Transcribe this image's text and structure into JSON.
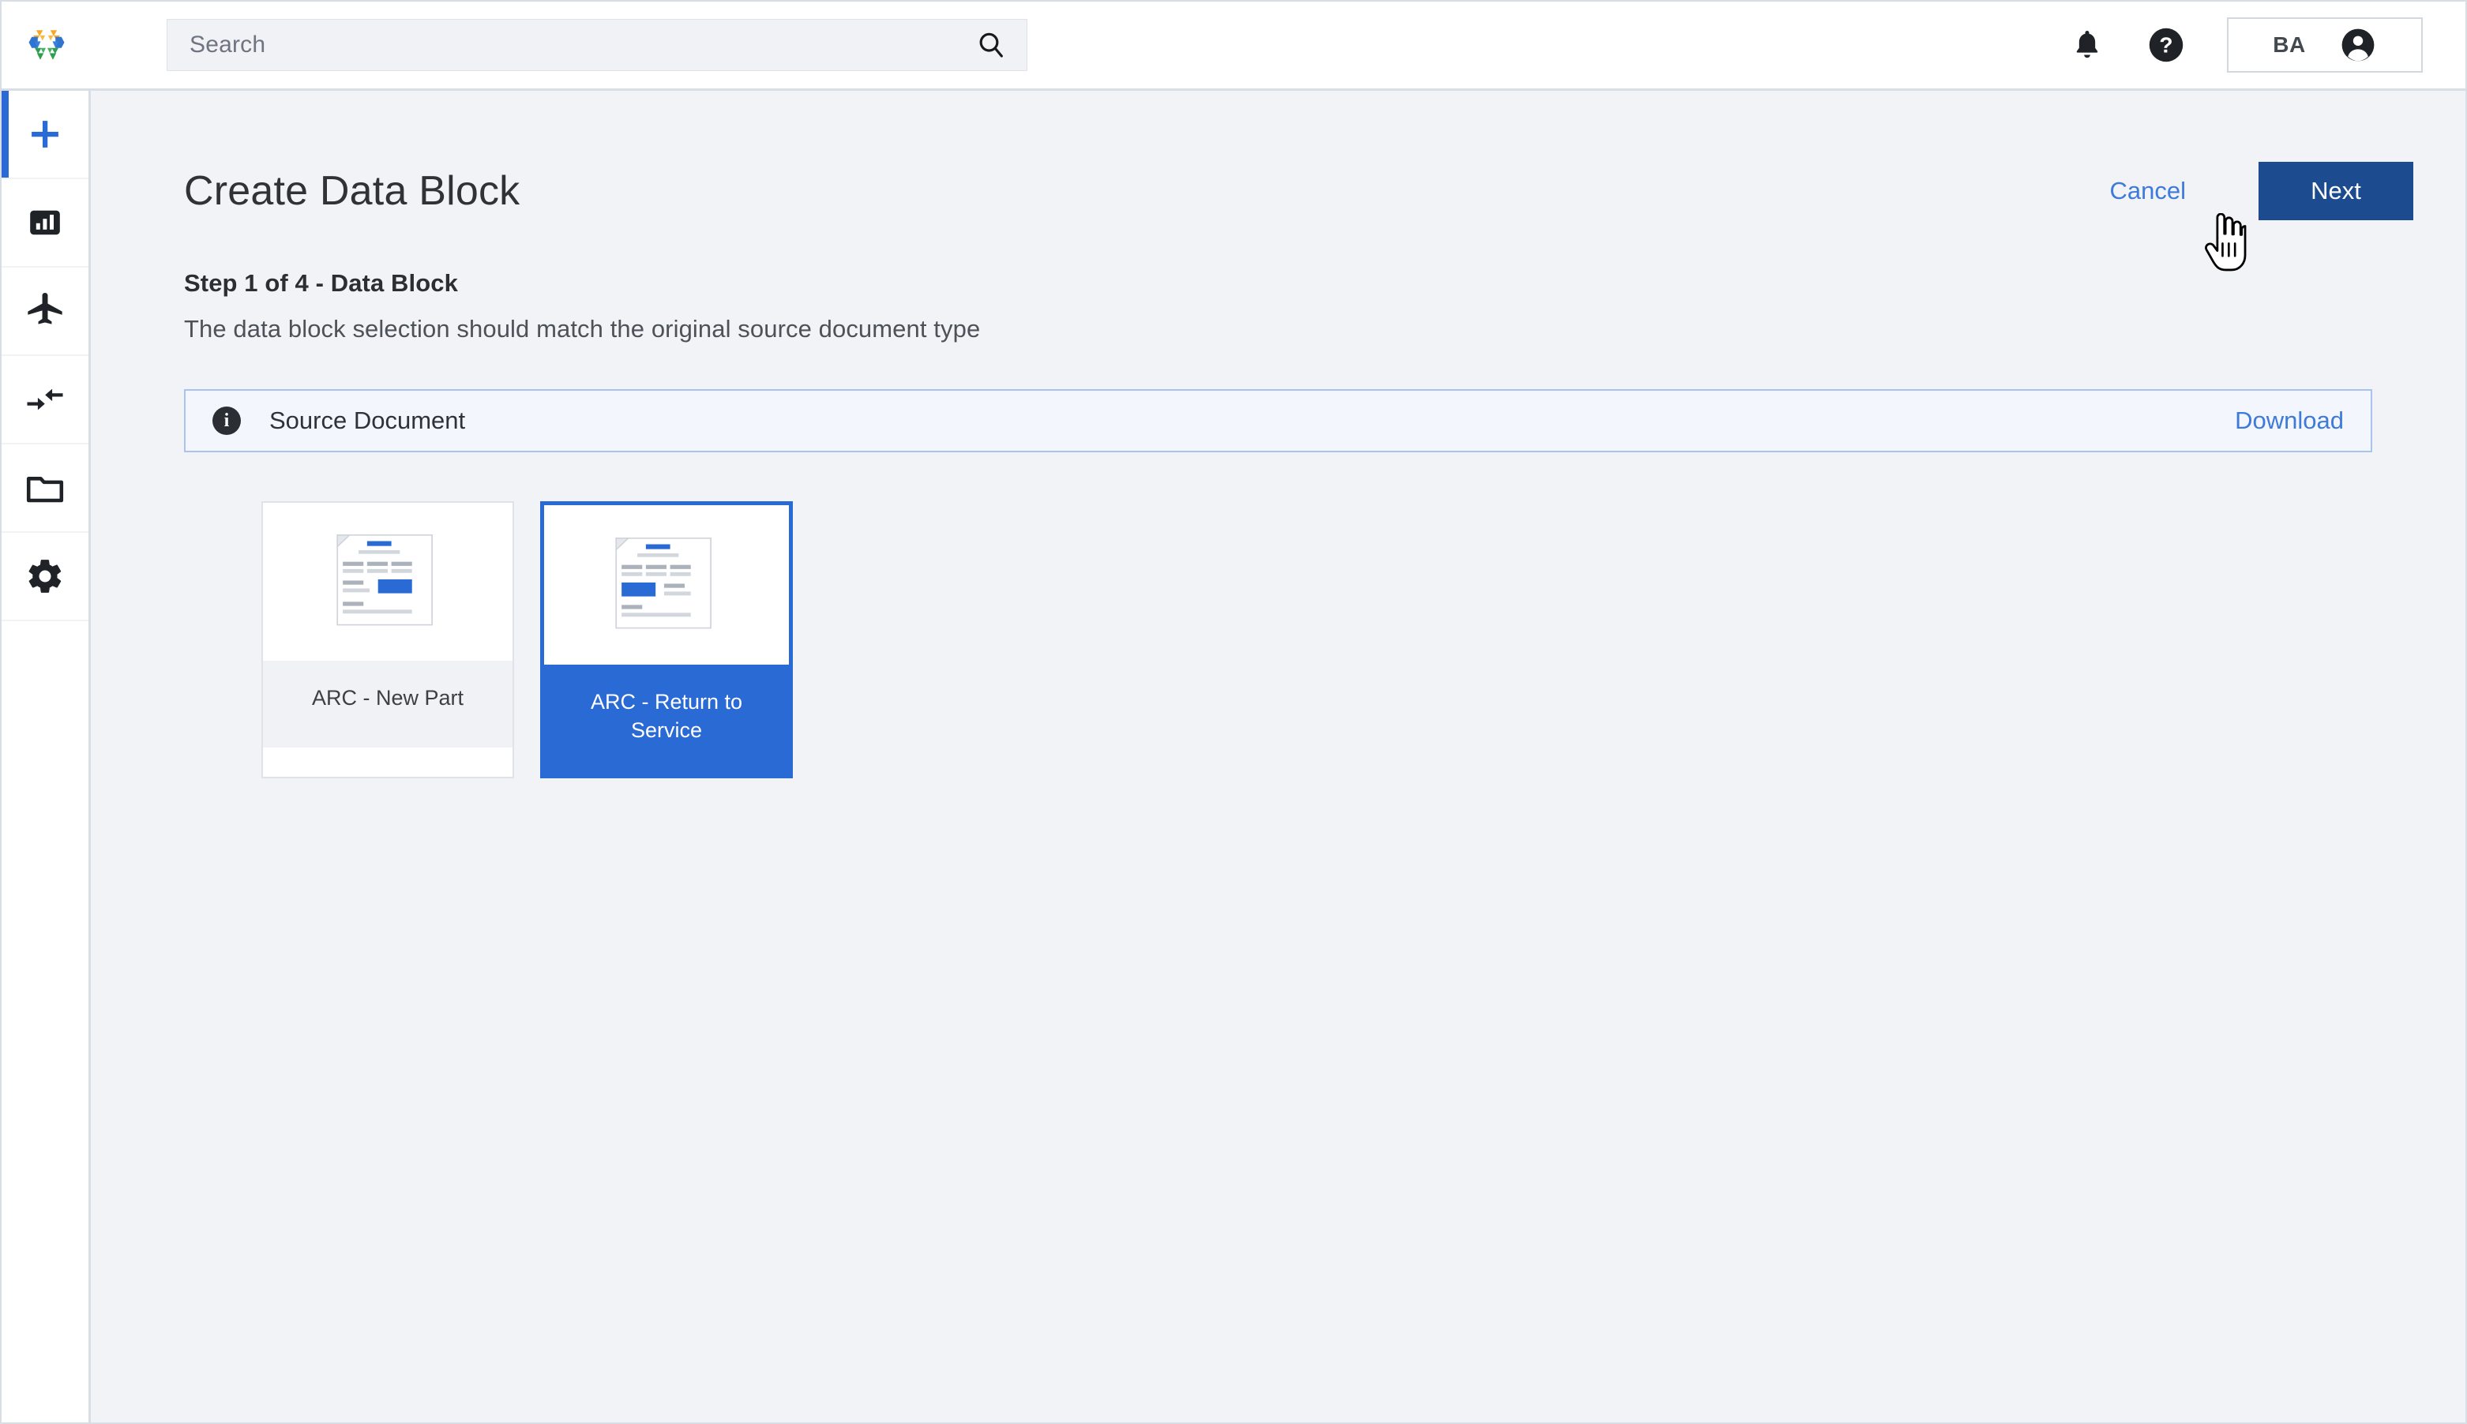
{
  "topbar": {
    "logo_name": "company-logo",
    "search": {
      "placeholder": "Search",
      "value": "",
      "icon": "search-icon"
    },
    "notifications_icon": "bell-icon",
    "help_icon": "help-circle-icon",
    "user": {
      "initials": "BA",
      "avatar_icon": "account-circle-icon"
    }
  },
  "sidebar": {
    "items": [
      {
        "name": "add",
        "icon": "plus-icon",
        "active": true
      },
      {
        "name": "reports",
        "icon": "bar-chart-icon",
        "active": false
      },
      {
        "name": "aircraft",
        "icon": "airplane-icon",
        "active": false
      },
      {
        "name": "transfers",
        "icon": "compress-arrows-icon",
        "active": false
      },
      {
        "name": "documents",
        "icon": "folder-icon",
        "active": false
      },
      {
        "name": "settings",
        "icon": "gear-icon",
        "active": false
      }
    ]
  },
  "page": {
    "title": "Create Data Block",
    "cancel_label": "Cancel",
    "next_label": "Next",
    "step_title": "Step 1 of 4 - Data Block",
    "step_description": "The data block selection should match the original source document type"
  },
  "info_bar": {
    "icon": "info-icon",
    "label": "Source Document",
    "action_label": "Download"
  },
  "data_blocks": [
    {
      "label": "ARC - New Part",
      "selected": false,
      "thumbnail": "document-preview-right-block"
    },
    {
      "label": "ARC - Return to Service",
      "selected": true,
      "thumbnail": "document-preview-left-block"
    }
  ],
  "colors": {
    "accent_blue": "#2a6ad4",
    "primary_button": "#1c4b8f",
    "link_blue": "#3e7ad9",
    "page_background": "#f1f3f7",
    "info_background": "#f3f7fd",
    "info_border": "#a9c3ec"
  },
  "cursor": {
    "type": "pointer-hand"
  }
}
